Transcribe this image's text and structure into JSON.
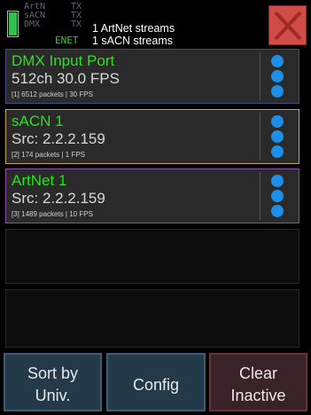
{
  "header": {
    "protocols": [
      {
        "name": "ArtN",
        "tx": "TX"
      },
      {
        "name": "sACN",
        "tx": "TX"
      },
      {
        "name": "DMX",
        "tx": "TX"
      }
    ],
    "network": "ENET",
    "stream_lines": [
      "1 ArtNet streams",
      "1 sACN streams"
    ],
    "battery_level": 1.0
  },
  "ports": [
    {
      "title": "DMX Input Port",
      "detail": "512ch 30.0 FPS",
      "stats": "[1] 6512 packets | 30 FPS",
      "border_color": "#3e4c8a"
    },
    {
      "title": "sACN 1",
      "detail": "Src: 2.2.2.159",
      "stats": "[2] 174 packets | 1 FPS",
      "border_color": "#c7a54a"
    },
    {
      "title": "ArtNet 1",
      "detail": "Src: 2.2.2.159",
      "stats": "[3] 1489 packets | 10 FPS",
      "border_color": "#8f4bb0"
    }
  ],
  "footer": {
    "sort_label": [
      "Sort by",
      "Univ."
    ],
    "config_label": "Config",
    "clear_label": [
      "Clear",
      "Inactive"
    ]
  },
  "colors": {
    "accent_green": "#27e51c",
    "menu_dot_blue": "#1e8fe8",
    "close_red": "#d14b47"
  },
  "icons": {
    "battery": "battery-icon",
    "close": "close-x-icon",
    "menu": "vertical-dots-icon"
  }
}
